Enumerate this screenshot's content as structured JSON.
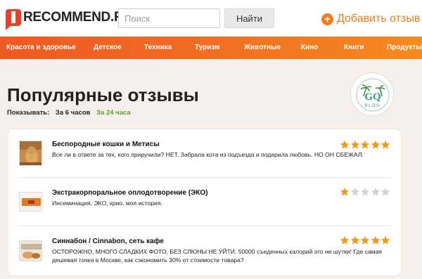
{
  "header": {
    "logo_text": "RECOMMEND.RU",
    "search_placeholder": "Поиск",
    "search_button": "Найти",
    "add_review": "Добавить отзыв",
    "brand_color": "#e8412b",
    "accent_color": "#f07a1e"
  },
  "nav": {
    "items": [
      "Красота и здоровье",
      "Детское",
      "Техника",
      "Туризм",
      "Животные",
      "Кино",
      "Книги",
      "Продукты"
    ]
  },
  "main": {
    "title": "Популярные отзывы",
    "show_label": "Показывать:",
    "periods": [
      "За 6 часов",
      "За 24 часа"
    ],
    "active_period": "За 24 часа"
  },
  "badge": {
    "text": "BLOG",
    "letters": "GQ"
  },
  "reviews": [
    {
      "title": "Беспородные кошки и Метисы",
      "text": "Все ли в ответе за тех, кого приручили? НЕТ. Забрала кота из подъезда и подарила любовь. НО ОН СБЕЖАЛ.",
      "rating": 5,
      "thumb_icon": "cat-photo-icon"
    },
    {
      "title": "Экстракорпоральное оплодотворение (ЭКО)",
      "text": "Инсеминация, ЭКО, крио, моя история.",
      "rating": 1,
      "thumb_icon": "medical-photo-icon"
    },
    {
      "title": "Синнабон / Cinnabon, сеть кафе",
      "text": "ОСТОРОЖНО, МНОГО СЛАДКИХ ФОТО, БЕЗ СЛЮНЫ НЕ УЙТИ. 50000 съеденных калорий это не шутки! Где самая дешевая точка в Москве, как сэкономить 30% от стоимости товара?",
      "rating": 5,
      "thumb_icon": "cafe-photo-icon"
    }
  ],
  "colors": {
    "star_filled": "#f29a1c",
    "star_empty": "#d3d3d3"
  }
}
